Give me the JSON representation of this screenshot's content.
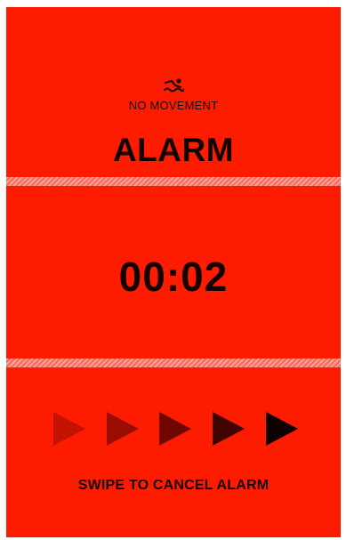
{
  "status": {
    "icon": "swimmer-icon",
    "label": "NO MOVEMENT"
  },
  "alarm": {
    "title": "ALARM"
  },
  "timer": {
    "value": "00:02"
  },
  "swipe": {
    "label": "SWIPE TO CANCEL ALARM",
    "arrow_icon": "play-arrow-icon"
  },
  "colors": {
    "background": "#fd1c00",
    "text": "#140000",
    "stripe": "#f5a39a"
  }
}
